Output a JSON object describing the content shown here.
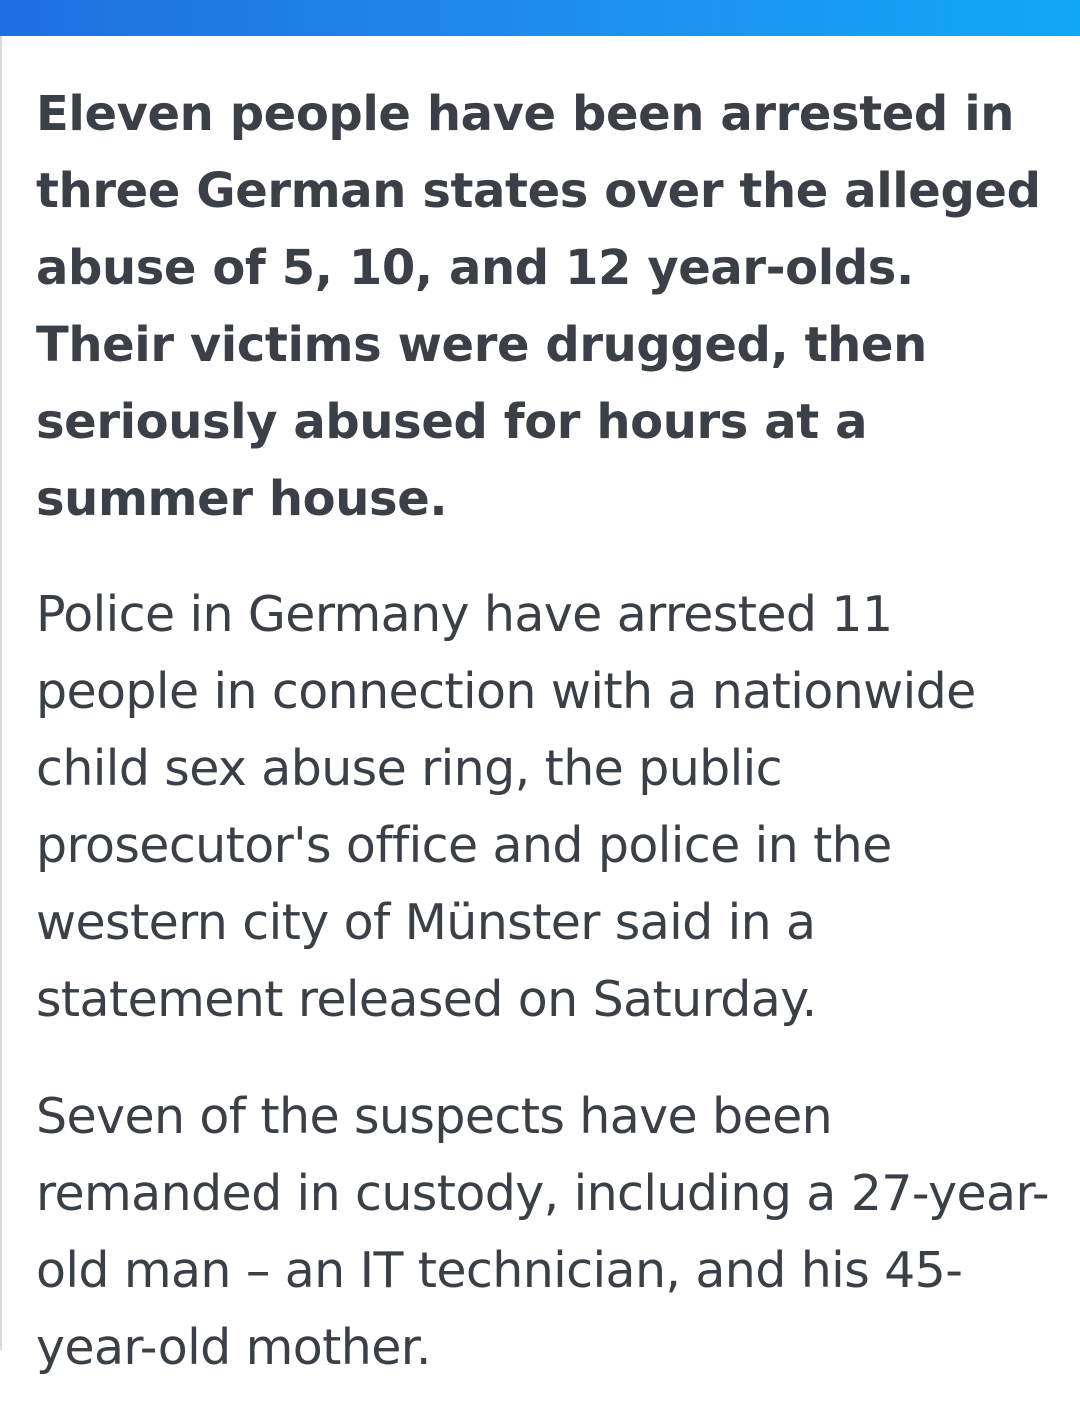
{
  "header": {
    "accent_start": "#1f6fe0",
    "accent_end": "#11a8f6"
  },
  "article": {
    "lead": "Eleven people have been arrested in three German states over the alleged abuse of 5, 10, and 12 year-olds. Their victims were drugged, then seriously abused for hours at a summer house.",
    "paragraphs": [
      "Police in Germany have arrested 11 people in connection with a nationwide child sex abuse ring, the public prosecutor's office and police in the western city of Münster said in a statement released on Saturday.",
      "Seven of the suspects have been remanded in custody, including a 27-year-old man – an IT technician, and his 45-year-old mother."
    ]
  },
  "colors": {
    "text": "#3b4048",
    "background": "#ffffff",
    "edge": "#d6dbe1"
  }
}
